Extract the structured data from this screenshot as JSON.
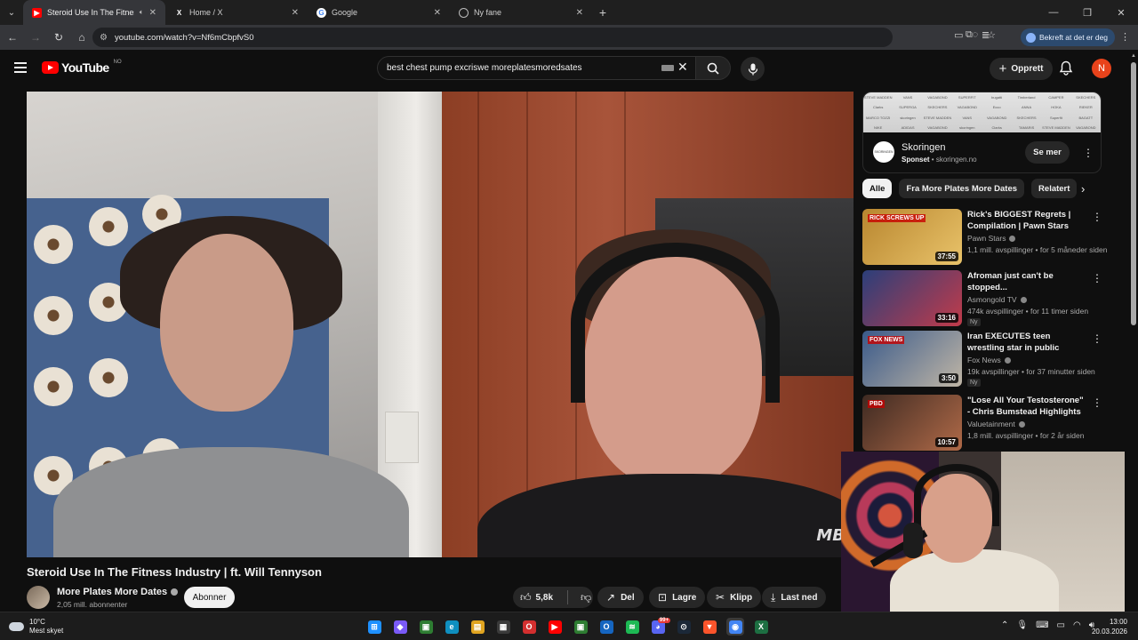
{
  "browser": {
    "tabs": [
      {
        "title": "Steroid Use In The Fitness Industry | ft. Will Tennyson - YouTube",
        "icon": "youtube-icon",
        "active": true
      },
      {
        "title": "Home / X",
        "icon": "x-icon",
        "active": false
      },
      {
        "title": "Google",
        "icon": "google-icon",
        "active": false
      },
      {
        "title": "Ny fane",
        "icon": "globe-icon",
        "active": false
      }
    ],
    "url": "youtube.com/watch?v=Nf6mCbpfvS0",
    "verify_pill": "Bekreft at det er deg"
  },
  "youtube": {
    "country_code": "NO",
    "logo_text": "YouTube",
    "search_query": "best chest pump excriswe moreplatesmoredsates",
    "create_label": "Opprett",
    "avatar_letter": "N"
  },
  "video": {
    "title": "Steroid Use In The Fitness Industry | ft. Will Tennyson",
    "channel": "More Plates More Dates",
    "subscribers": "2,05 mill. abonnenter",
    "subscribe_label": "Abonner",
    "like_count": "5,8k",
    "share_label": "Del",
    "save_label": "Lagre",
    "clip_label": "Klipp",
    "download_label": "Last ned",
    "watermark": "MB"
  },
  "ad": {
    "name": "Skoringen",
    "sponsored": "Sponset",
    "domain": "skoringen.no",
    "cta": "Se mer",
    "logo_text": "SKORINGEN",
    "brands": [
      "STEVE MADDEN",
      "VANS",
      "VAGABOND",
      "SUPERFIT",
      "bugatti",
      "Timberland",
      "CAMPER",
      "SKECHERS",
      "Clarks",
      "SUPERGA",
      "SKECHERS",
      "VAGABOND",
      "Ecco",
      "ANNA",
      "HOKA",
      "RIEKER",
      "MARCO TOZZI",
      "skoringen",
      "STEVE MADDEN",
      "VANS",
      "VAGABOND",
      "SKECHERS",
      "Superfit",
      "BAGATT",
      "NIKE",
      "ADIDAS",
      "VAGABOND",
      "skoringen",
      "Clarks",
      "TAMARIS",
      "STEVE MADDEN",
      "VAGABOND"
    ]
  },
  "chips": [
    "Alle",
    "Fra More Plates More Dates",
    "Relatert"
  ],
  "recommendations": [
    {
      "title": "Rick's BIGGEST Regrets | Compilation | Pawn Stars",
      "channel": "Pawn Stars",
      "verified": true,
      "stats": "1,1 mill. avspillinger • for 5 måneder siden",
      "duration": "37:55",
      "badge": "",
      "thumb_colors": [
        "#b8862f",
        "#e9c36a"
      ],
      "thumb_text": "RICK SCREWS UP"
    },
    {
      "title": "Afroman just can't be stopped...",
      "channel": "Asmongold TV",
      "verified": true,
      "stats": "474k avspillinger • for 11 timer siden",
      "duration": "33:16",
      "badge": "Ny",
      "thumb_colors": [
        "#2b3f7a",
        "#c23b4a"
      ],
      "thumb_text": ""
    },
    {
      "title": "Iran EXECUTES teen wrestling star in public",
      "channel": "Fox News",
      "verified": true,
      "stats": "19k avspillinger • for 37 minutter siden",
      "duration": "3:50",
      "badge": "Ny",
      "thumb_colors": [
        "#3a5a8a",
        "#c0b6a6"
      ],
      "thumb_text": "FOX NEWS"
    },
    {
      "title": "\"Lose All Your Testosterone\" - Chris Bumstead Highlights the...",
      "channel": "Valuetainment",
      "verified": true,
      "stats": "1,8 mill. avspillinger • for 2 år siden",
      "duration": "10:57",
      "badge": "",
      "thumb_colors": [
        "#3e2a22",
        "#b06a48"
      ],
      "thumb_text": "PBD"
    }
  ],
  "taskbar": {
    "temperature": "10°C",
    "weather": "Mest skyet",
    "time": "13:00",
    "date": "20.03.2026",
    "apps": [
      "windows-icon",
      "copilot-icon",
      "app-icon",
      "edge-icon",
      "explorer-icon",
      "store-icon",
      "opera-icon",
      "youtube-icon",
      "app-icon",
      "outlook-icon",
      "spotify-icon",
      "discord-icon",
      "steam-icon",
      "brave-icon",
      "chrome-icon",
      "excel-icon"
    ],
    "discord_badge": "99+"
  }
}
